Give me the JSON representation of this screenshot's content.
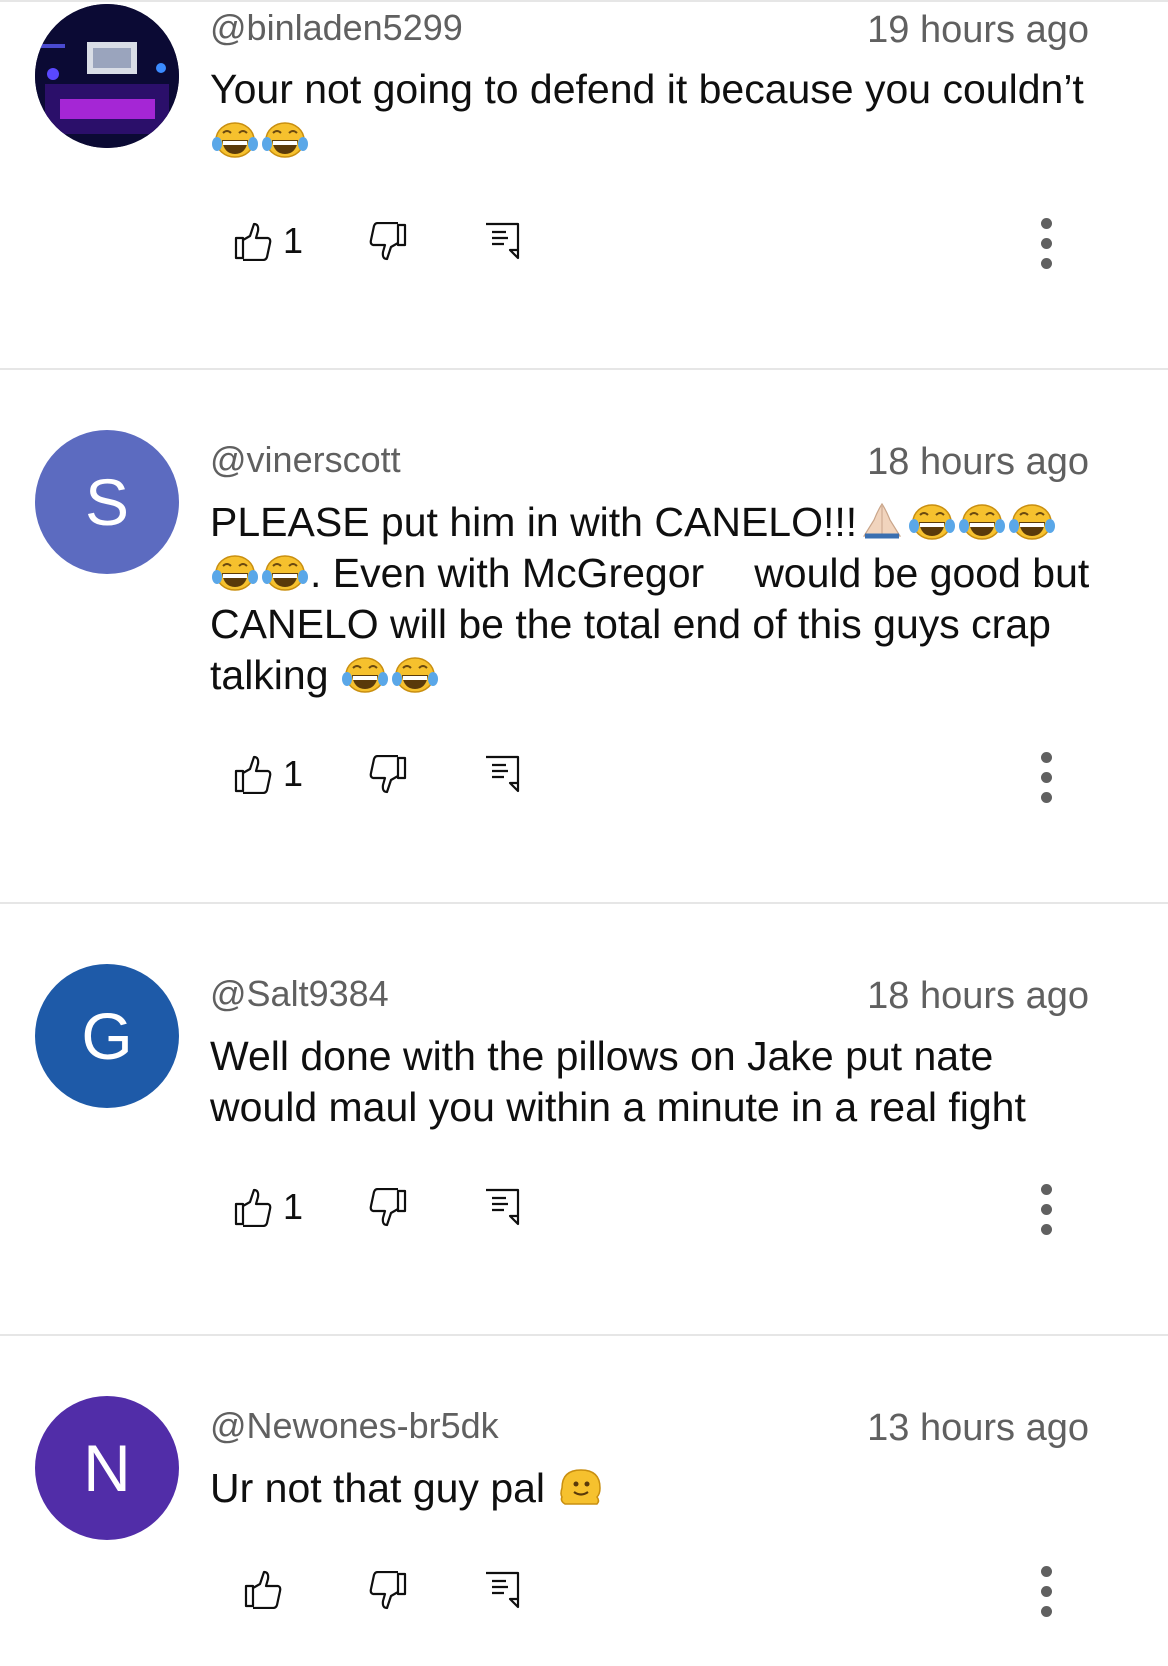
{
  "comments": [
    {
      "handle": "@binladen5299",
      "time": "19 hours ago",
      "avatar": {
        "type": "image",
        "name": "gaming-setup-avatar"
      },
      "text_parts": [
        "Your not going to defend it because you couldn’t"
      ],
      "likes": "1"
    },
    {
      "handle": "@vinerscott",
      "time": "18 hours ago",
      "avatar": {
        "type": "letter",
        "letter": "S",
        "color": "#5c6bc0"
      },
      "text_parts": [
        "PLEASE put him in with CANELO!!!",
        ".  Even with McGregor",
        "would be good but CANELO will be the total end of this guys crap talking"
      ],
      "likes": "1"
    },
    {
      "handle": "@Salt9384",
      "time": "18 hours ago",
      "avatar": {
        "type": "letter",
        "letter": "G",
        "color": "#1e5aa8"
      },
      "text_parts": [
        "Well done with the pillows on Jake put nate would maul you within a minute in a real fight"
      ],
      "likes": "1"
    },
    {
      "handle": "@Newones-br5dk",
      "time": "13 hours ago",
      "avatar": {
        "type": "letter",
        "letter": "N",
        "color": "#512da8"
      },
      "text_parts": [
        "Ur not that guy pal"
      ],
      "likes": ""
    }
  ],
  "icons": {
    "like": "thumb-up-icon",
    "dislike": "thumb-down-icon",
    "reply": "reply-icon",
    "more": "more-vert-icon",
    "emoji_laugh": "face-with-tears-of-joy-emoji",
    "emoji_pray": "folded-hands-emoji",
    "emoji_melt": "melting-face-emoji"
  },
  "colors": {
    "secondary_text": "#606060",
    "divider": "#e6e6e6"
  }
}
